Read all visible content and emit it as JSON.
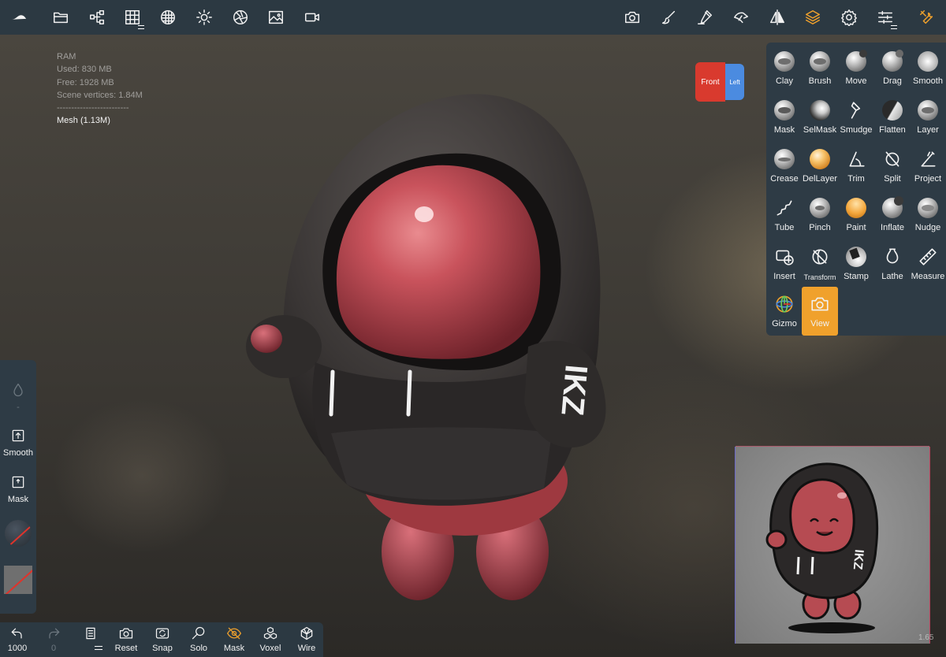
{
  "stats": {
    "ram_label": "RAM",
    "used": "Used: 830 MB",
    "free": "Free: 1928 MB",
    "scene_vertices": "Scene vertices: 1.84M",
    "separator": "-------------------------",
    "mesh": "Mesh (1.13M)"
  },
  "top_toolbar": {
    "icons": [
      "nomad-logo-icon",
      "folder-icon",
      "scene-tree-icon",
      "topology-grid-icon",
      "material-sphere-icon",
      "light-sun-icon",
      "postprocess-shutter-icon",
      "background-image-icon",
      "video-record-icon",
      "camera-icon",
      "paint-brush-icon",
      "stroke-pen-icon",
      "interface-icon",
      "symmetry-icon",
      "layers-icon",
      "settings-gear-icon",
      "sliders-icon",
      "tools-icon"
    ]
  },
  "view_cube": {
    "front": "Front",
    "left": "Left"
  },
  "tools": [
    {
      "label": "Clay"
    },
    {
      "label": "Brush"
    },
    {
      "label": "Move"
    },
    {
      "label": "Drag"
    },
    {
      "label": "Smooth"
    },
    {
      "label": "Mask"
    },
    {
      "label": "SelMask"
    },
    {
      "label": "Smudge"
    },
    {
      "label": "Flatten"
    },
    {
      "label": "Layer"
    },
    {
      "label": "Crease"
    },
    {
      "label": "DelLayer"
    },
    {
      "label": "Trim"
    },
    {
      "label": "Split"
    },
    {
      "label": "Project"
    },
    {
      "label": "Tube"
    },
    {
      "label": "Pinch"
    },
    {
      "label": "Paint"
    },
    {
      "label": "Inflate"
    },
    {
      "label": "Nudge"
    },
    {
      "label": "Insert"
    },
    {
      "label": "Transform"
    },
    {
      "label": "Stamp"
    },
    {
      "label": "Lathe"
    },
    {
      "label": "Measure"
    },
    {
      "label": "Gizmo"
    },
    {
      "label": "View"
    }
  ],
  "active_tool": "View",
  "left_panel": {
    "dash": "-",
    "smooth": "Smooth",
    "mask": "Mask"
  },
  "bottom_toolbar": {
    "undo_count": "1000",
    "redo_count": "0",
    "reset": "Reset",
    "snap": "Snap",
    "solo": "Solo",
    "mask": "Mask",
    "voxel": "Voxel",
    "wire": "Wire"
  },
  "reference": {
    "zoom": "1.65",
    "hoodie_text": "IKZ"
  },
  "model": {
    "hoodie_text": "IKZ"
  },
  "colors": {
    "accent": "#f0a12c",
    "panel": "#2e3b45",
    "toolbar": "#2c3942",
    "cube_front": "#d93a2e",
    "cube_left": "#4b8be0"
  }
}
